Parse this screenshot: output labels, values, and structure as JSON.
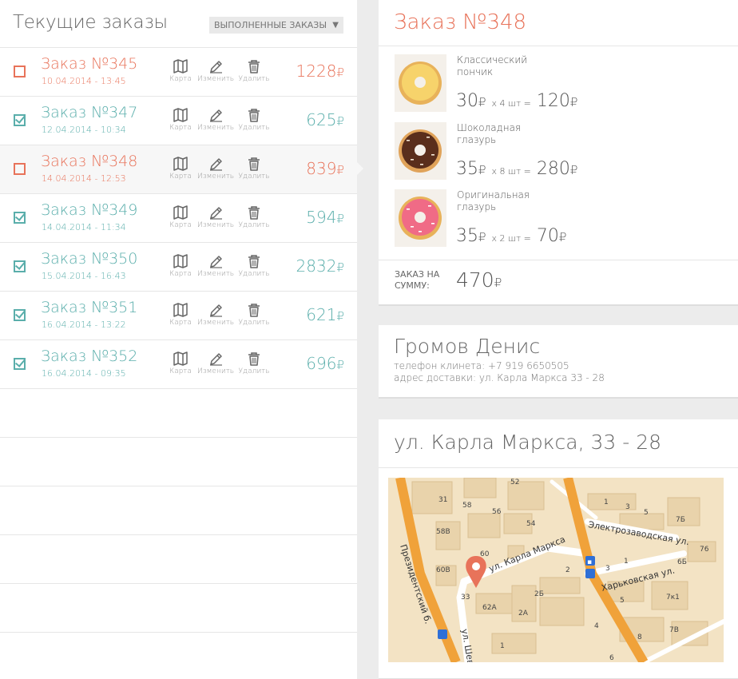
{
  "left": {
    "title": "Текущие заказы",
    "done_orders_button": "выполненные заказы",
    "orders": [
      {
        "title": "Заказ №345",
        "date": "10.04.2014 - 13:45",
        "price": "1228",
        "status": "pending",
        "checked": false,
        "active": false
      },
      {
        "title": "Заказ №347",
        "date": "12.04.2014 - 10:34",
        "price": "625",
        "status": "done",
        "checked": true,
        "active": false
      },
      {
        "title": "Заказ №348",
        "date": "14.04.2014 - 12:53",
        "price": "839",
        "status": "pending",
        "checked": false,
        "active": true
      },
      {
        "title": "Заказ №349",
        "date": "14.04.2014 - 11:34",
        "price": "594",
        "status": "done",
        "checked": true,
        "active": false
      },
      {
        "title": "Заказ №350",
        "date": "15.04.2014 - 16:43",
        "price": "2832",
        "status": "done",
        "checked": true,
        "active": false
      },
      {
        "title": "Заказ №351",
        "date": "16.04.2014 - 13:22",
        "price": "621",
        "status": "done",
        "checked": true,
        "active": false
      },
      {
        "title": "Заказ №352",
        "date": "16.04.2014 - 09:35",
        "price": "696",
        "status": "done",
        "checked": true,
        "active": false
      }
    ],
    "actions": {
      "map": "Карта",
      "edit": "Изменить",
      "delete": "Удалить"
    },
    "currency": "₽"
  },
  "order_detail": {
    "title": "Заказ №348",
    "items": [
      {
        "name": "Классический пончик",
        "price": "30",
        "qty_text": "x 4 шт =",
        "total": "120",
        "image": "classic-donut"
      },
      {
        "name": "Шоколадная глазурь",
        "price": "35",
        "qty_text": "x 8 шт =",
        "total": "280",
        "image": "chocolate-donut"
      },
      {
        "name": "Оригинальная глазурь",
        "price": "35",
        "qty_text": "x 2 шт =",
        "total": "70",
        "image": "pink-donut"
      }
    ],
    "sum_label": "заказ на сумму:",
    "sum_value": "470"
  },
  "client": {
    "name": "Громов Денис",
    "phone_line": "телефон клинета: +7 919 6650505",
    "address_line": "адрес доставки: ул. Карла Маркса 33 - 28"
  },
  "address": {
    "title": "ул. Карла Маркса, 33 - 28",
    "map": {
      "streets": [
        "ул. Карла Маркса",
        "Президентский б.",
        "Электрозаводская ул.",
        "Харьковская ул.",
        "ул. Шевч"
      ],
      "house_numbers": [
        "52",
        "31",
        "58",
        "56",
        "58В",
        "54",
        "60",
        "60В",
        "33",
        "62А",
        "2",
        "2Б",
        "2А",
        "1",
        "3",
        "5",
        "7Б",
        "76",
        "6Б",
        "7к1",
        "4",
        "7В",
        "6",
        "8",
        "1",
        "3",
        "5"
      ]
    }
  },
  "colors": {
    "accent_orange": "#e8735a",
    "accent_teal": "#5aaeab"
  }
}
